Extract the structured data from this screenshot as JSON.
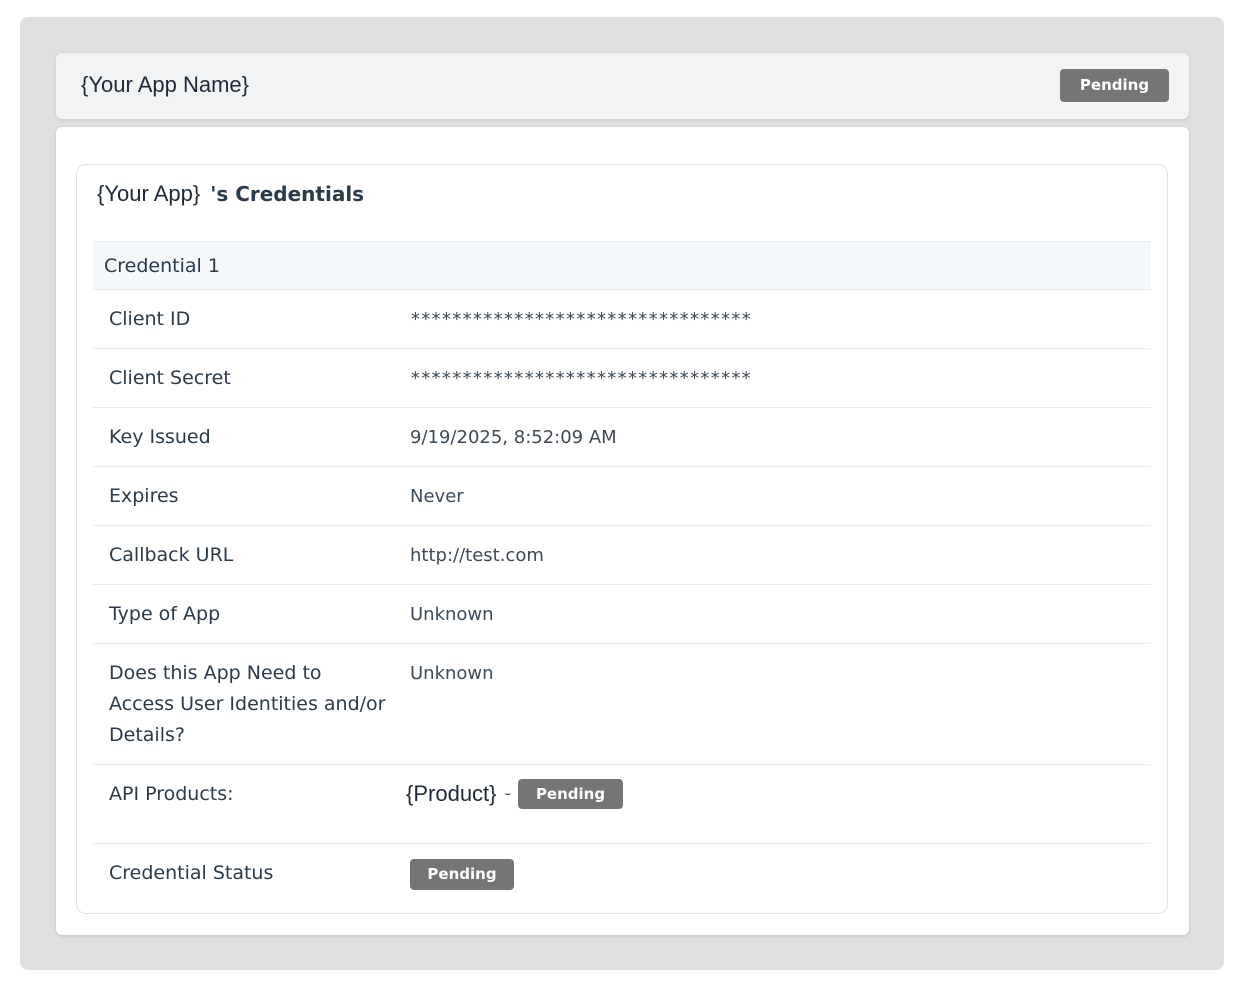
{
  "header": {
    "app_name": "{Your App Name}",
    "status_badge": "Pending"
  },
  "credentials": {
    "title_app": "{Your App}",
    "title_suffix": "'s Credentials",
    "section_label": "Credential 1",
    "rows": [
      {
        "label": "Client ID",
        "value": "*********************************"
      },
      {
        "label": "Client Secret",
        "value": "*********************************"
      },
      {
        "label": "Key Issued",
        "value": "9/19/2025, 8:52:09 AM"
      },
      {
        "label": "Expires",
        "value": "Never"
      },
      {
        "label": "Callback URL",
        "value": "http://test.com"
      },
      {
        "label": "Type of App",
        "value": "Unknown"
      },
      {
        "label": "Does this App Need to Access User Identities and/or Details?",
        "value": "Unknown"
      }
    ],
    "api_products": {
      "label": "API Products:",
      "product_name": "{Product}",
      "separator": "-",
      "product_status": "Pending"
    },
    "credential_status": {
      "label": "Credential Status",
      "value": "Pending"
    }
  },
  "colors": {
    "badge_bg": "#757575",
    "badge_text": "#ffffff",
    "page_bg": "#e0e0e0",
    "section_bg": "#f4f8fb"
  }
}
